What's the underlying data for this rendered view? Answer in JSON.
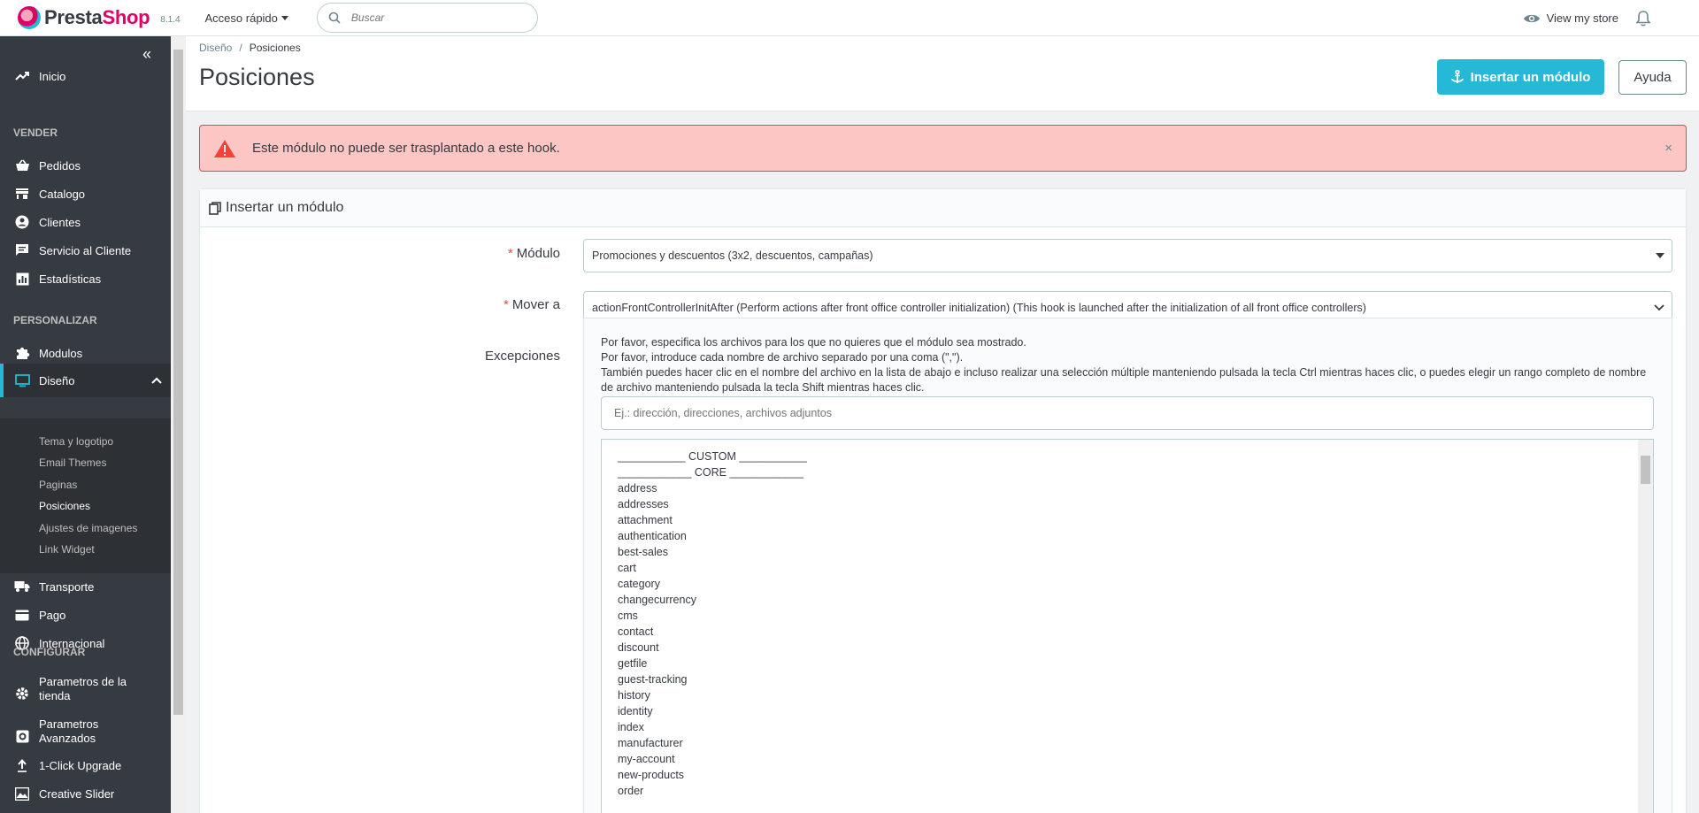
{
  "header": {
    "logo_text_1": "Presta",
    "logo_text_2": "Shop",
    "version": "8.1.4",
    "quick_access": "Acceso rápido",
    "search_placeholder": "Buscar",
    "view_store": "View my store"
  },
  "sidebar": {
    "items": [
      {
        "label": "Inicio",
        "icon": "trending-up-icon"
      },
      {
        "label": "Pedidos",
        "icon": "basket-icon"
      },
      {
        "label": "Catalogo",
        "icon": "store-icon"
      },
      {
        "label": "Clientes",
        "icon": "account-circle-icon"
      },
      {
        "label": "Servicio al Cliente",
        "icon": "chat-icon"
      },
      {
        "label": "Estadísticas",
        "icon": "chart-icon"
      },
      {
        "label": "Modulos",
        "icon": "puzzle-icon"
      },
      {
        "label": "Diseño",
        "icon": "desktop-icon"
      },
      {
        "label": "Transporte",
        "icon": "truck-icon"
      },
      {
        "label": "Pago",
        "icon": "credit-card-icon"
      },
      {
        "label": "Internacional",
        "icon": "globe-icon"
      },
      {
        "label_1": "Parametros de la",
        "label_2": "tienda",
        "icon": "gear-icon"
      },
      {
        "label_1": "Parametros",
        "label_2": "Avanzados",
        "icon": "settings-box-icon"
      },
      {
        "label": "1-Click Upgrade",
        "icon": "upload-icon"
      },
      {
        "label": "Creative Slider",
        "icon": "image-icon"
      }
    ],
    "sections": [
      "VENDER",
      "PERSONALIZAR",
      "CONFIGURAR"
    ],
    "sub_items": [
      "Tema y logotipo",
      "Email Themes",
      "Paginas",
      "Posiciones",
      "Ajustes de imagenes",
      "Link Widget"
    ]
  },
  "page": {
    "breadcrumb_parent": "Diseño",
    "breadcrumb_current": "Posiciones",
    "title": "Posiciones",
    "primary_button": "Insertar un módulo",
    "help_button": "Ayuda"
  },
  "alert": {
    "text": "Este módulo no puede ser trasplantado a este hook.",
    "close": "×"
  },
  "panel": {
    "title": "Insertar un módulo",
    "module_label": "Módulo",
    "module_value": "Promociones y descuentos (3x2, descuentos, campañas)",
    "move_label": "Mover a",
    "move_value": "actionFrontControllerInitAfter (Perform actions after front office controller initialization) (This hook is launched after the initialization of all front office controllers)",
    "exceptions_label": "Excepciones",
    "help_1": "Por favor, especifica los archivos para los que no quieres que el módulo sea mostrado.",
    "help_2": "Por favor, introduce cada nombre de archivo separado por una coma (\",\").",
    "help_3": "También puedes hacer clic en el nombre del archivo en la lista de abajo e incluso realizar una selección múltiple manteniendo pulsada la tecla Ctrl mientras haces clic, o puedes elegir un rango completo de nombre de archivo manteniendo pulsada la tecla Shift mientras haces clic.",
    "input_placeholder": "Ej.: dirección, direcciones, archivos adjuntos",
    "files": [
      "___________ CUSTOM ___________",
      "____________ CORE ____________",
      "address",
      "addresses",
      "attachment",
      "authentication",
      "best-sales",
      "cart",
      "category",
      "changecurrency",
      "cms",
      "contact",
      "discount",
      "getfile",
      "guest-tracking",
      "history",
      "identity",
      "index",
      "manufacturer",
      "my-account",
      "new-products",
      "order"
    ]
  },
  "colors": {
    "accent": "#25b9d7",
    "sidebar_bg": "#363a41",
    "alert_bg": "#fbc6c3",
    "alert_border": "#f44336",
    "brand_pink": "#df0067"
  }
}
